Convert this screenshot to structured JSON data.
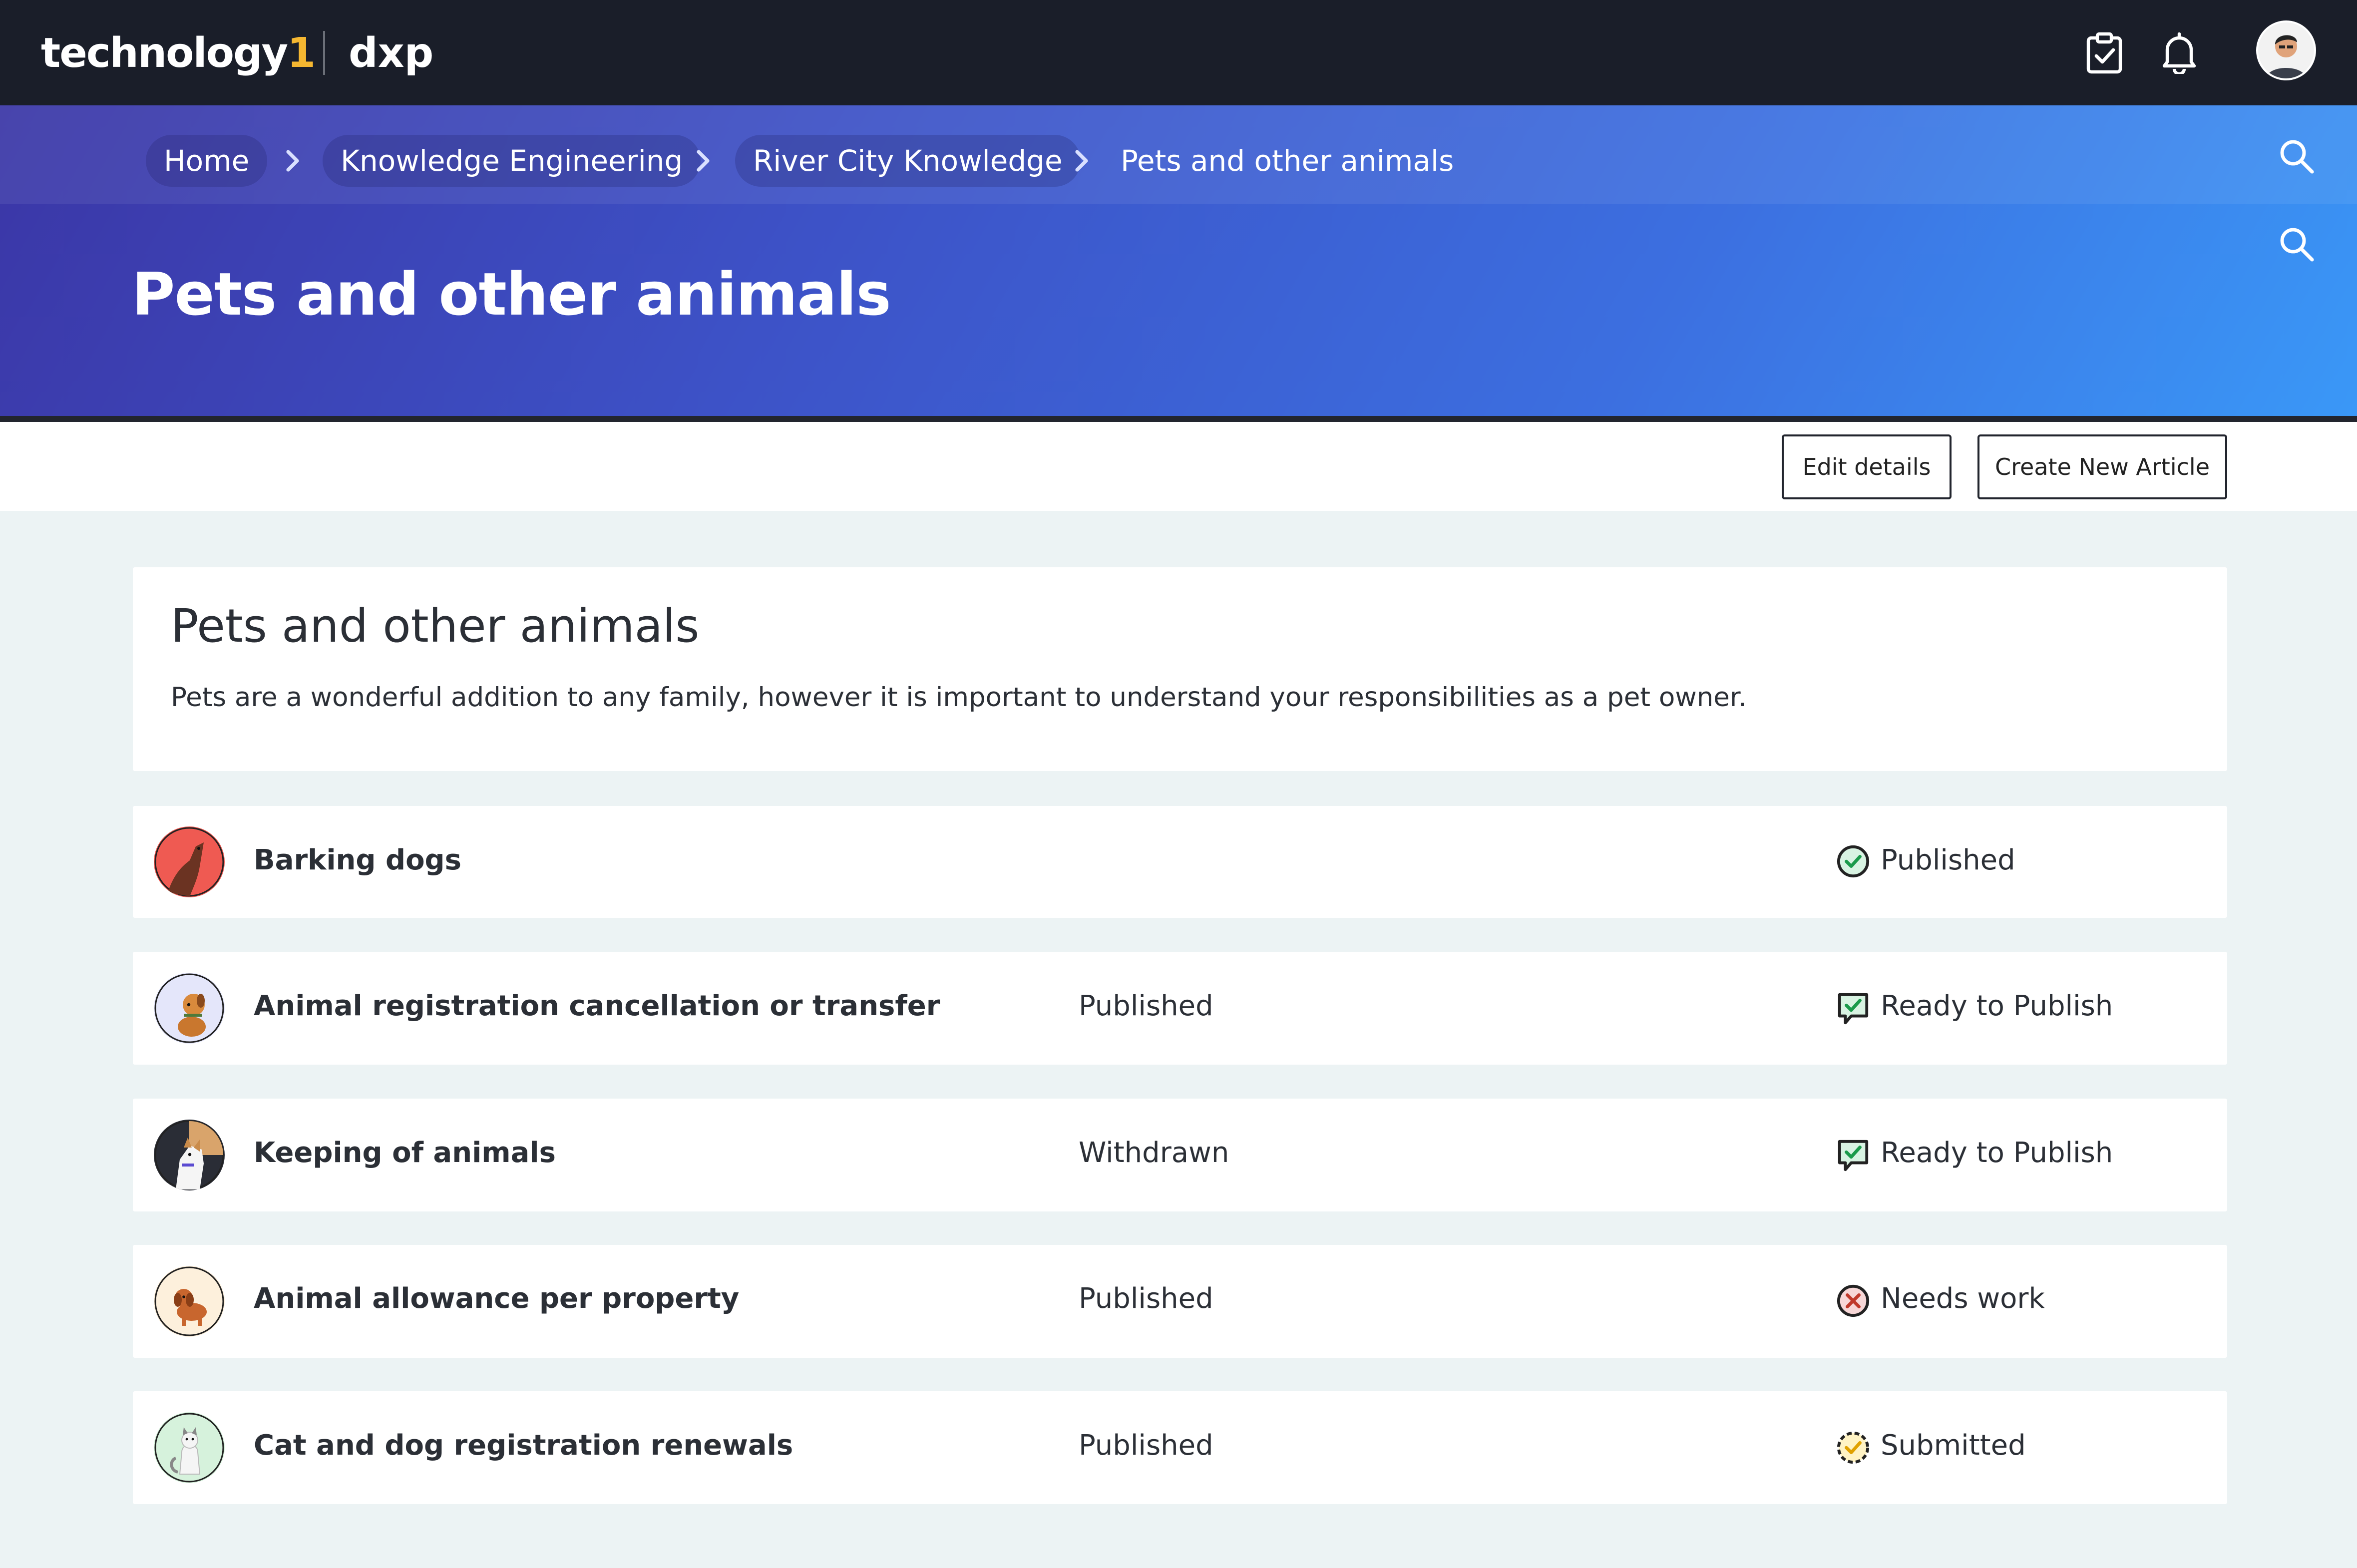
{
  "brand": {
    "name": "technology",
    "mark": "1",
    "product": "dxp"
  },
  "colors": {
    "topbar": "#1a1e29",
    "accent": "#f5b731",
    "header_start": "#3b36a6",
    "header_end": "#3a98f7",
    "published": "#1a9a4a",
    "ready": "#1a9a4a",
    "needs_work": "#c0392b",
    "submitted": "#e0a100"
  },
  "topbar": {
    "icons": [
      "clipboard-check-icon",
      "bell-icon",
      "user-avatar"
    ]
  },
  "breadcrumb": [
    {
      "label": "Home"
    },
    {
      "label": "Knowledge Engineering"
    },
    {
      "label": "River City Knowledge"
    },
    {
      "label": "Pets and other animals"
    }
  ],
  "page": {
    "title": "Pets and other animals"
  },
  "actions": {
    "edit_label": "Edit details",
    "create_label": "Create New Article"
  },
  "intro": {
    "title": "Pets and other animals",
    "description": "Pets are a wonderful addition to any family, however it is important to understand your responsibilities as a pet owner."
  },
  "articles": [
    {
      "title": "Barking dogs",
      "state": "",
      "status": "Published",
      "status_icon": "check-circle-icon"
    },
    {
      "title": "Animal registration cancellation or transfer",
      "state": "Published",
      "status": "Ready to Publish",
      "status_icon": "check-chat-icon"
    },
    {
      "title": "Keeping of animals",
      "state": "Withdrawn",
      "status": "Ready to Publish",
      "status_icon": "check-chat-icon"
    },
    {
      "title": "Animal allowance per property",
      "state": "Published",
      "status": "Needs work",
      "status_icon": "x-circle-icon"
    },
    {
      "title": "Cat and dog registration renewals",
      "state": "Published",
      "status": "Submitted",
      "status_icon": "dashed-check-circle-icon"
    }
  ]
}
